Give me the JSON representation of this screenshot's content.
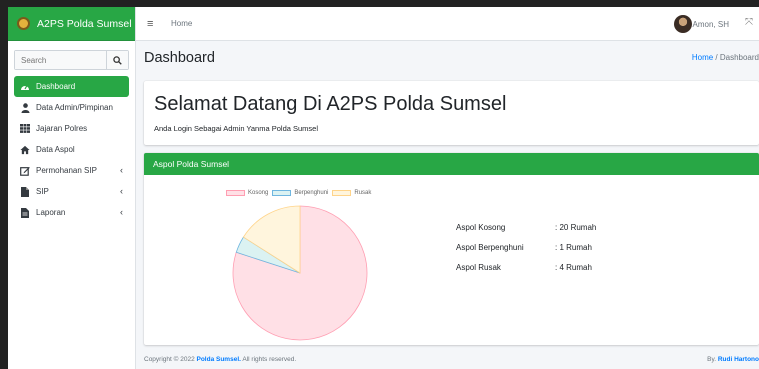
{
  "brand": {
    "name": "A2PS Polda Sumsel"
  },
  "search": {
    "placeholder": "Search"
  },
  "sidebar": {
    "items": [
      {
        "label": "Dashboard",
        "icon": "dashboard-icon",
        "active": true
      },
      {
        "label": "Data Admin/Pimpinan",
        "icon": "user-icon"
      },
      {
        "label": "Jajaran Polres",
        "icon": "grid-icon"
      },
      {
        "label": "Data Aspol",
        "icon": "home-icon"
      },
      {
        "label": "Permohanan SIP",
        "icon": "edit-icon",
        "caret": "‹"
      },
      {
        "label": "SIP",
        "icon": "file-icon",
        "caret": "‹"
      },
      {
        "label": "Laporan",
        "icon": "document-icon",
        "caret": "‹"
      }
    ]
  },
  "topbar": {
    "home_link": "Home",
    "user_name": "Amon, SH"
  },
  "header": {
    "title": "Dashboard",
    "breadcrumb_home": "Home",
    "breadcrumb_sep": " / ",
    "breadcrumb_current": "Dashboard"
  },
  "welcome": {
    "title": "Selamat Datang Di A2PS Polda Sumsel",
    "subtitle": "Anda Login Sebagai Admin Yanma Polda Sumsel"
  },
  "aspol": {
    "title": "Aspol Polda Sumsel",
    "stats": [
      {
        "label": "Aspol Kosong",
        "value": ": 20 Rumah"
      },
      {
        "label": "Aspol Berpenghuni",
        "value": ": 1 Rumah"
      },
      {
        "label": "Aspol Rusak",
        "value": ": 4 Rumah"
      }
    ]
  },
  "chart_data": {
    "type": "pie",
    "categories": [
      "Kosong",
      "Berpenghuni",
      "Rusak"
    ],
    "values": [
      20,
      1,
      4
    ],
    "colors": [
      "#ffe0e6",
      "#dbf2f2",
      "#fff5dd"
    ],
    "borders": [
      "#ff9eb2",
      "#6fb6e0",
      "#ffd48a"
    ],
    "legend": "top"
  },
  "footer": {
    "copyright_prefix": "Copyright © 2022 ",
    "copyright_brand": "Polda Sumsel.",
    "copyright_suffix": " All rights reserved.",
    "by_prefix": "By. ",
    "by_name": "Rudi Hartono"
  },
  "colors": {
    "accent": "#28a745",
    "link": "#007bff"
  }
}
